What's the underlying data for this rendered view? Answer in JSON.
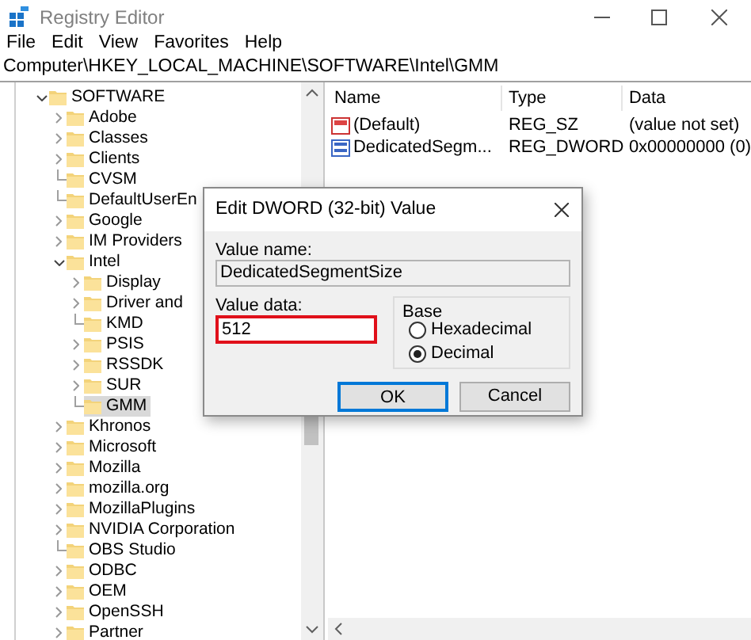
{
  "window": {
    "title": "Registry Editor"
  },
  "menu": [
    "File",
    "Edit",
    "View",
    "Favorites",
    "Help"
  ],
  "address": "Computer\\HKEY_LOCAL_MACHINE\\SOFTWARE\\Intel\\GMM",
  "tree": [
    {
      "label": "SOFTWARE",
      "kind": "expanded",
      "selected": false,
      "children": [
        {
          "label": "Adobe",
          "kind": "collapsed",
          "selected": false
        },
        {
          "label": "Classes",
          "kind": "collapsed",
          "selected": false
        },
        {
          "label": "Clients",
          "kind": "collapsed",
          "selected": false
        },
        {
          "label": "CVSM",
          "kind": "leaf",
          "selected": false
        },
        {
          "label": "DefaultUserEn",
          "kind": "leaf",
          "selected": false
        },
        {
          "label": "Google",
          "kind": "collapsed",
          "selected": false
        },
        {
          "label": "IM Providers",
          "kind": "collapsed",
          "selected": false
        },
        {
          "label": "Intel",
          "kind": "expanded",
          "selected": false,
          "children": [
            {
              "label": "Display",
              "kind": "collapsed",
              "selected": false
            },
            {
              "label": "Driver and",
              "kind": "collapsed",
              "selected": false
            },
            {
              "label": "KMD",
              "kind": "leaf",
              "selected": false
            },
            {
              "label": "PSIS",
              "kind": "collapsed",
              "selected": false
            },
            {
              "label": "RSSDK",
              "kind": "collapsed",
              "selected": false
            },
            {
              "label": "SUR",
              "kind": "collapsed",
              "selected": false
            },
            {
              "label": "GMM",
              "kind": "leaf",
              "selected": true
            }
          ]
        },
        {
          "label": "Khronos",
          "kind": "collapsed",
          "selected": false
        },
        {
          "label": "Microsoft",
          "kind": "collapsed",
          "selected": false
        },
        {
          "label": "Mozilla",
          "kind": "collapsed",
          "selected": false
        },
        {
          "label": "mozilla.org",
          "kind": "collapsed",
          "selected": false
        },
        {
          "label": "MozillaPlugins",
          "kind": "collapsed",
          "selected": false
        },
        {
          "label": "NVIDIA Corporation",
          "kind": "collapsed",
          "selected": false
        },
        {
          "label": "OBS Studio",
          "kind": "leaf",
          "selected": false
        },
        {
          "label": "ODBC",
          "kind": "collapsed",
          "selected": false
        },
        {
          "label": "OEM",
          "kind": "collapsed",
          "selected": false
        },
        {
          "label": "OpenSSH",
          "kind": "collapsed",
          "selected": false
        },
        {
          "label": "Partner",
          "kind": "collapsed",
          "selected": false
        }
      ]
    }
  ],
  "values": {
    "columns": [
      "Name",
      "Type",
      "Data"
    ],
    "rows": [
      {
        "kind": "string",
        "name": "(Default)",
        "type": "REG_SZ",
        "data": "(value not set)"
      },
      {
        "kind": "binary",
        "name": "DedicatedSegm...",
        "type": "REG_DWORD",
        "data": "0x00000000 (0)"
      }
    ]
  },
  "dialog": {
    "title": "Edit DWORD (32-bit) Value",
    "value_name": {
      "label": "Value name:",
      "value": "DedicatedSegmentSize"
    },
    "value_data": {
      "label": "Value data:",
      "value": "512",
      "highlighted": true
    },
    "base": {
      "label": "Base",
      "options": [
        {
          "label": "Hexadecimal",
          "selected": false
        },
        {
          "label": "Decimal",
          "selected": true
        }
      ]
    },
    "buttons": [
      {
        "label": "OK",
        "default": true
      },
      {
        "label": "Cancel",
        "default": false
      }
    ]
  }
}
